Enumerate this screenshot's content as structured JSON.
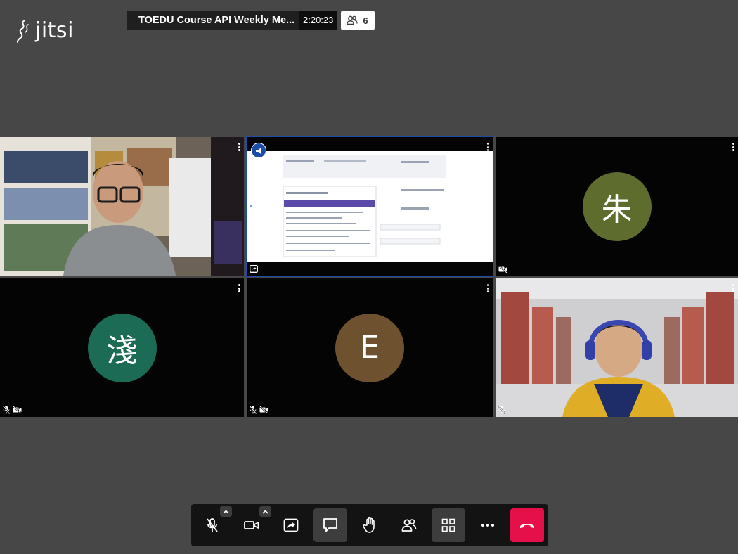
{
  "app": {
    "logo_text": "jitsi"
  },
  "header": {
    "meeting_title": "TOEDU Course API Weekly Me...",
    "elapsed_time": "2:20:23",
    "participant_count": "6"
  },
  "tiles": [
    {
      "id": "tile-1",
      "kind": "camera",
      "name": ""
    },
    {
      "id": "tile-2",
      "kind": "screen-share",
      "name": ""
    },
    {
      "id": "tile-3",
      "kind": "avatar",
      "initial": "朱",
      "color": "#5e6c2e"
    },
    {
      "id": "tile-4",
      "kind": "avatar",
      "initial": "淺",
      "color": "#1c6b55"
    },
    {
      "id": "tile-5",
      "kind": "avatar",
      "initial": "E",
      "color": "#6e5230"
    },
    {
      "id": "tile-6",
      "kind": "camera",
      "name": ""
    }
  ],
  "colors": {
    "background": "#474747",
    "toolbar": "#131313",
    "hangup": "#e5104a",
    "active_border": "#1c4ca5"
  },
  "toolbar": {
    "buttons": [
      {
        "name": "microphone",
        "icon": "mic-muted-icon"
      },
      {
        "name": "camera",
        "icon": "camera-icon"
      },
      {
        "name": "share-screen",
        "icon": "screenshare-icon"
      },
      {
        "name": "chat",
        "icon": "chat-icon"
      },
      {
        "name": "raise-hand",
        "icon": "hand-icon"
      },
      {
        "name": "participants",
        "icon": "participants-icon"
      },
      {
        "name": "tile-view",
        "icon": "grid-icon"
      },
      {
        "name": "more",
        "icon": "more-icon"
      },
      {
        "name": "hangup",
        "icon": "hangup-icon"
      }
    ]
  }
}
